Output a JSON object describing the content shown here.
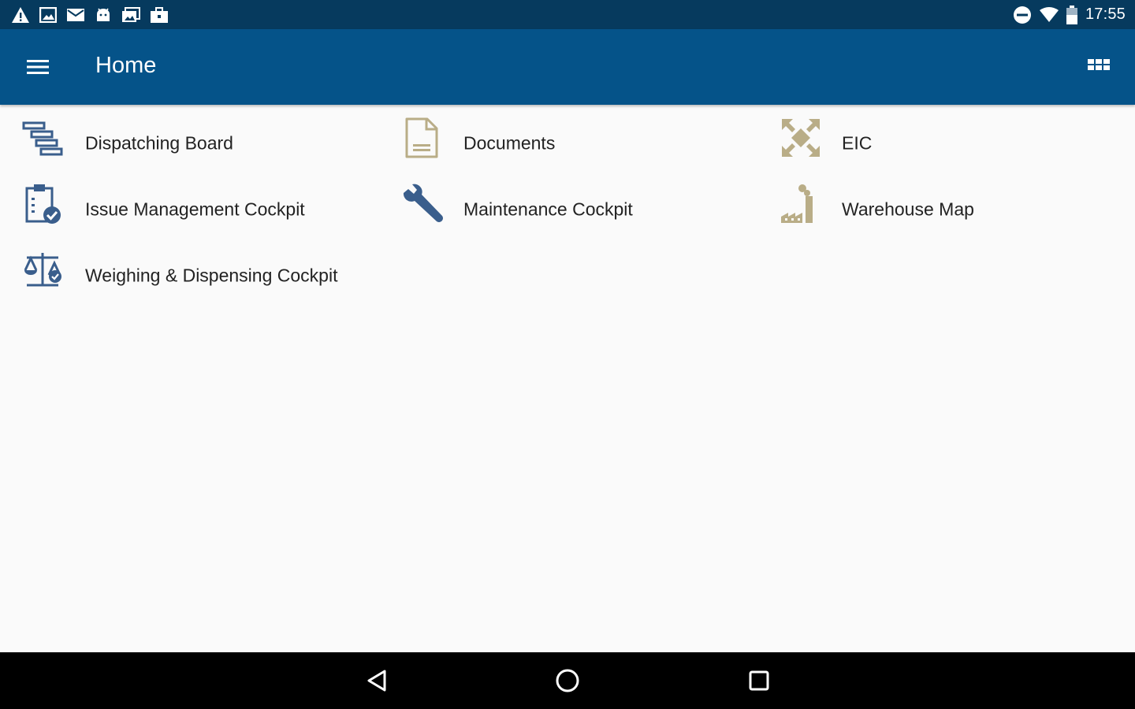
{
  "status_bar": {
    "time": "17:55",
    "left_icons": [
      "warning-icon",
      "image-icon",
      "mail-icon",
      "android-icon",
      "photos-icon",
      "briefcase-icon"
    ],
    "right_icons": [
      "do-not-disturb-icon",
      "wifi-icon",
      "battery-icon"
    ]
  },
  "app_bar": {
    "title": "Home",
    "menu_icon": "menu-icon",
    "apps_icon": "apps-grid-icon"
  },
  "tiles": [
    {
      "label": "Dispatching Board",
      "icon": "dispatching-board-icon"
    },
    {
      "label": "Documents",
      "icon": "document-icon"
    },
    {
      "label": "EIC",
      "icon": "expand-arrows-icon"
    },
    {
      "label": "Issue Management Cockpit",
      "icon": "clipboard-check-icon"
    },
    {
      "label": "Maintenance Cockpit",
      "icon": "wrench-icon"
    },
    {
      "label": "Warehouse Map",
      "icon": "factory-icon"
    },
    {
      "label": "Weighing & Dispensing Cockpit",
      "icon": "scale-icon"
    }
  ],
  "nav_bar": {
    "back_icon": "back-icon",
    "home_icon": "home-icon",
    "recents_icon": "recents-icon"
  },
  "colors": {
    "status_bar": "#063a5e",
    "app_bar": "#055389",
    "icon_blue": "#3a5e8c",
    "icon_gold": "#b9ad87",
    "background": "#fafafa"
  }
}
